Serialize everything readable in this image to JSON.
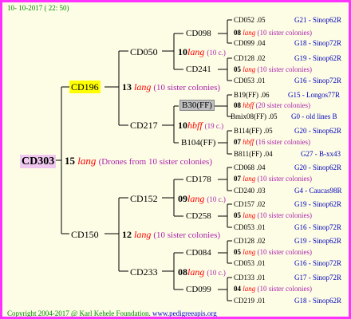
{
  "header": {
    "date": "10- 10-2017 ( 22: 50)"
  },
  "root": {
    "label": "CD303",
    "count": "15",
    "lang": "lang",
    "note": "(Drones from 10 sister colonies)"
  },
  "gen1": [
    {
      "label": "CD196",
      "count": "13",
      "lang": "lang",
      "note": "(10 sister colonies)"
    },
    {
      "label": "CD150",
      "count": "12",
      "lang": "lang",
      "note": "(10 sister colonies)"
    }
  ],
  "gen2": [
    {
      "label": "CD050",
      "count": "10",
      "lang": "lang",
      "note": "(10 c.)"
    },
    {
      "label": "CD217",
      "count": "10",
      "lang": "hbff",
      "note": "(19 c.)"
    },
    {
      "label": "CD152",
      "count": "09",
      "lang": "lang",
      "note": "(10 c.)"
    },
    {
      "label": "CD233",
      "count": "08",
      "lang": "lang",
      "note": "(10 c.)"
    }
  ],
  "gen3": [
    {
      "label": "CD098",
      "count": "08",
      "lang": "lang",
      "note": "(10 sister colonies)"
    },
    {
      "label": "CD241",
      "count": "05",
      "lang": "lang",
      "note": "(10 sister colonies)"
    },
    {
      "label": "B30(FF)",
      "count": "08",
      "lang": "hbff",
      "note": "(20 sister colonies)"
    },
    {
      "label": "B104(FF)",
      "count": "07",
      "lang": "hbff",
      "note": "(16 sister colonies)"
    },
    {
      "label": "CD178",
      "count": "07",
      "lang": "lang",
      "note": "(10 sister colonies)"
    },
    {
      "label": "CD258",
      "count": "05",
      "lang": "lang",
      "note": "(10 sister colonies)"
    },
    {
      "label": "CD084",
      "count": "05",
      "lang": "lang",
      "note": "(10 sister colonies)"
    },
    {
      "label": "CD099",
      "count": "04",
      "lang": "lang",
      "note": "(10 sister colonies)"
    }
  ],
  "gen4": [
    {
      "label": "CD052 .05",
      "src": "G21 - Sinop62R"
    },
    {
      "label": "CD099 .04",
      "src": "G18 - Sinop72R"
    },
    {
      "label": "CD128 .02",
      "src": "G19 - Sinop62R"
    },
    {
      "label": "CD053 .01",
      "src": "G16 - Sinop72R"
    },
    {
      "label": "B19(FF) .06",
      "src": "G15 - Longos77R"
    },
    {
      "label": "Bmix08(FF) .05",
      "src": "G0 - old lines B"
    },
    {
      "label": "B114(FF) .05",
      "src": "G20 - Sinop62R"
    },
    {
      "label": "B811(FF) .04",
      "src": "G27 - B-xx43"
    },
    {
      "label": "CD068 .04",
      "src": "G20 - Sinop62R"
    },
    {
      "label": "CD240 .03",
      "src": "G4 - Caucas98R"
    },
    {
      "label": "CD157 .02",
      "src": "G19 - Sinop62R"
    },
    {
      "label": "CD053 .01",
      "src": "G16 - Sinop72R"
    },
    {
      "label": "CD128 .02",
      "src": "G19 - Sinop62R"
    },
    {
      "label": "CD053 .01",
      "src": "G16 - Sinop72R"
    },
    {
      "label": "CD133 .01",
      "src": "G17 - Sinop72R"
    },
    {
      "label": "CD219 .01",
      "src": "G18 - Sinop62R"
    }
  ],
  "footer": {
    "copyright": "Copyright 2004-2017 @ Karl Kehele Foundation.",
    "site": "www.pedigreeapis.org"
  }
}
